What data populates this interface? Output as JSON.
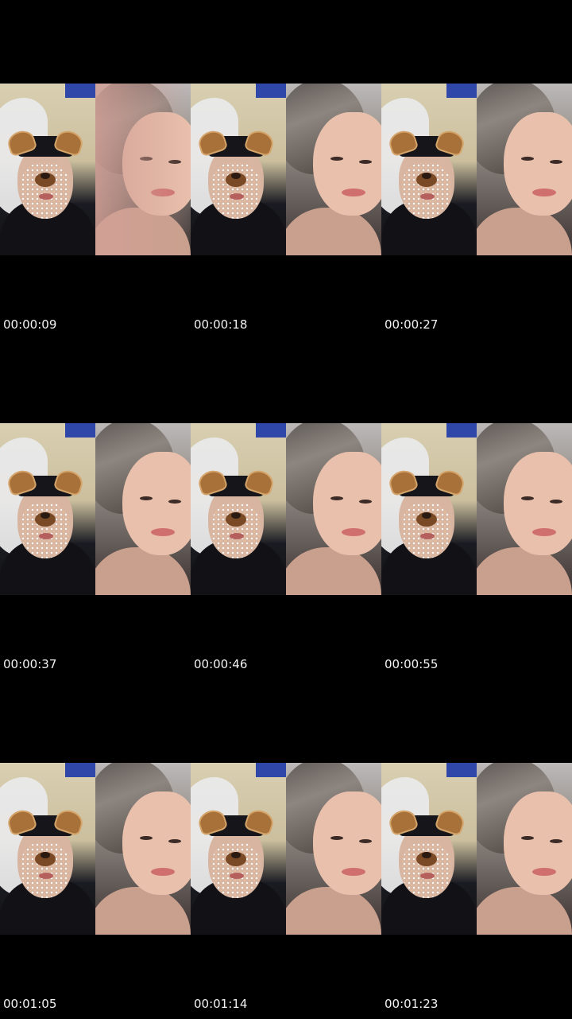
{
  "frames": [
    {
      "timestamp": "00:00:09"
    },
    {
      "timestamp": "00:00:18"
    },
    {
      "timestamp": "00:00:27"
    },
    {
      "timestamp": "00:00:37"
    },
    {
      "timestamp": "00:00:46"
    },
    {
      "timestamp": "00:00:55"
    },
    {
      "timestamp": "00:01:05"
    },
    {
      "timestamp": "00:01:14"
    },
    {
      "timestamp": "00:01:23"
    }
  ],
  "colors": {
    "background": "#000000",
    "timestamp_text": "#f2f2f2"
  }
}
